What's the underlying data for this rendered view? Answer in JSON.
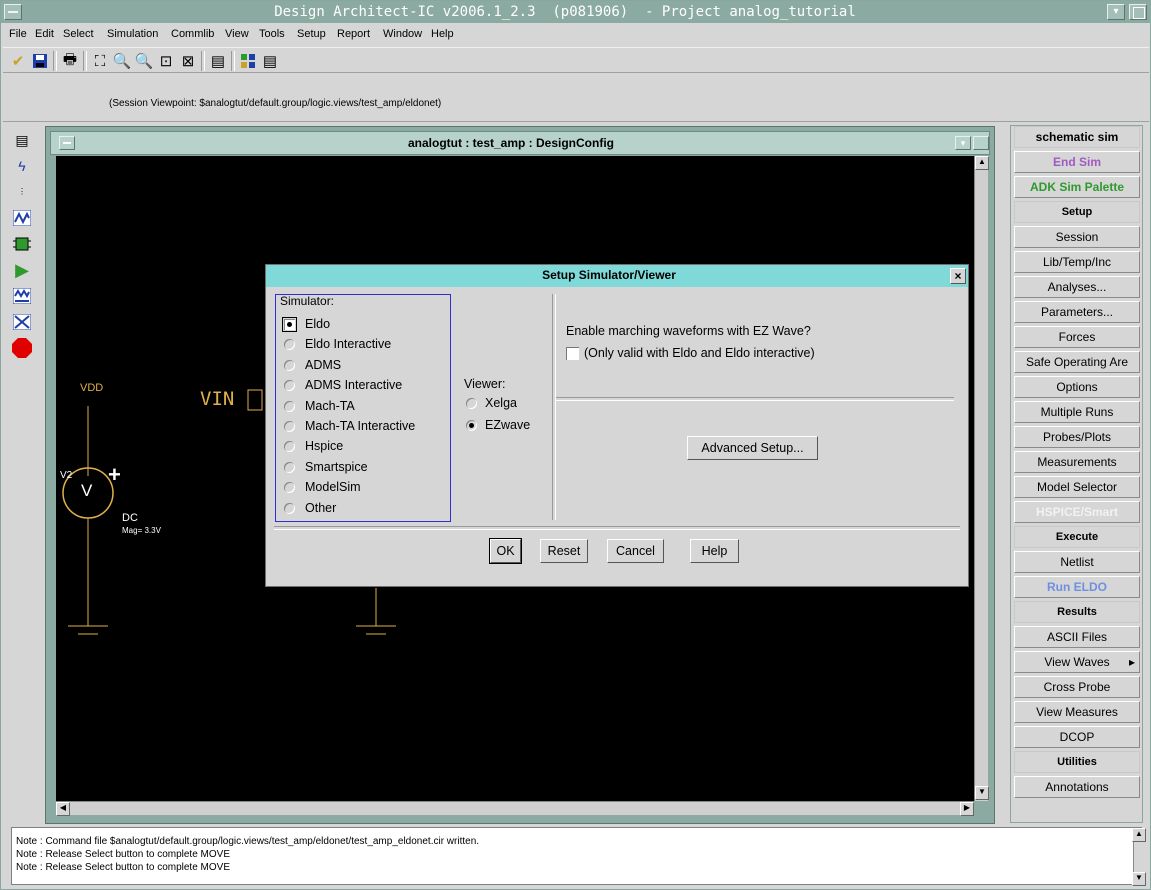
{
  "window": {
    "title": "Design Architect-IC v2006.1_2.3  (p081906)  - Project analog_tutorial"
  },
  "menu": [
    "File",
    "Edit",
    "Select",
    "Simulation",
    "Commlib",
    "View",
    "Tools",
    "Setup",
    "Report",
    "Window",
    "Help"
  ],
  "session_viewpoint": "(Session Viewpoint: $analogtut/default.group/logic.views/test_amp/eldonet)",
  "schematic": {
    "title": "analogtut : test_amp : DesignConfig",
    "vdd_label": "VDD",
    "vin_label": "VIN",
    "v2_label": "V2",
    "plus": "+",
    "source_symbol": "V",
    "dc_label": "DC",
    "mag_label": "Mag= 3.3V"
  },
  "dialog": {
    "title": "Setup Simulator/Viewer",
    "close": "×",
    "simulator_label": "Simulator:",
    "simulators": [
      "Eldo",
      "Eldo Interactive",
      "ADMS",
      "ADMS Interactive",
      "Mach-TA",
      "Mach-TA Interactive",
      "Hspice",
      "Smartspice",
      "ModelSim",
      "Other"
    ],
    "selected_simulator": "Eldo",
    "viewer_label": "Viewer:",
    "viewers": [
      "Xelga",
      "EZwave"
    ],
    "selected_viewer": "EZwave",
    "marching_question": "Enable marching waveforms with EZ Wave?",
    "marching_note": "(Only valid with Eldo and Eldo interactive)",
    "advanced_button": "Advanced Setup...",
    "ok": "OK",
    "reset": "Reset",
    "cancel": "Cancel",
    "help": "Help"
  },
  "palette": {
    "title": "schematic sim",
    "items": [
      {
        "label": "End Sim",
        "kind": "button",
        "color": "#a05ac0"
      },
      {
        "label": "ADK Sim Palette",
        "kind": "button",
        "color": "#2e9a2e"
      },
      {
        "label": "Setup",
        "kind": "header"
      },
      {
        "label": "Session",
        "kind": "button"
      },
      {
        "label": "Lib/Temp/Inc",
        "kind": "button"
      },
      {
        "label": "Analyses...",
        "kind": "button"
      },
      {
        "label": "Parameters...",
        "kind": "button"
      },
      {
        "label": "Forces",
        "kind": "button"
      },
      {
        "label": "Safe Operating Are",
        "kind": "button"
      },
      {
        "label": "Options",
        "kind": "button"
      },
      {
        "label": "Multiple Runs",
        "kind": "button"
      },
      {
        "label": "Probes/Plots",
        "kind": "button"
      },
      {
        "label": "Measurements",
        "kind": "button"
      },
      {
        "label": "Model Selector",
        "kind": "button"
      },
      {
        "label": "HSPICE/Smart",
        "kind": "button",
        "color": "#f2f2f2"
      },
      {
        "label": "Execute",
        "kind": "header"
      },
      {
        "label": "Netlist",
        "kind": "button"
      },
      {
        "label": "Run ELDO",
        "kind": "button",
        "color": "#6f8fe0"
      },
      {
        "label": "Results",
        "kind": "header"
      },
      {
        "label": "ASCII Files",
        "kind": "button"
      },
      {
        "label": "View Waves",
        "kind": "button",
        "submenu": "▸"
      },
      {
        "label": "Cross Probe",
        "kind": "button"
      },
      {
        "label": "View Measures",
        "kind": "button"
      },
      {
        "label": "DCOP",
        "kind": "button"
      },
      {
        "label": "Utilities",
        "kind": "header"
      },
      {
        "label": "Annotations",
        "kind": "button"
      }
    ]
  },
  "status_notes": [
    "Note : Command file $analogtut/default.group/logic.views/test_amp/eldonet/test_amp_eldonet.cir written.",
    "Note : Release Select button to complete MOVE",
    "Note : Release Select button to complete MOVE"
  ],
  "toolbar_icons": [
    "check-icon",
    "save-icon",
    "print-icon",
    "zoom-fit-icon",
    "zoom-in-icon",
    "zoom-out-icon",
    "zoom-area-icon",
    "zoom-sheet-icon",
    "panel-icon",
    "palette-icon",
    "list-icon"
  ],
  "left_icons": [
    "notes-icon",
    "lightning-icon",
    "tran-dc-ac-icon",
    "waveform-icon",
    "chip-icon",
    "play-icon",
    "waveform-compare-icon",
    "cross-probe-icon",
    "stop-icon"
  ],
  "colors": {
    "schematic_wire": "#e0b04a",
    "schematic_text": "#e0b04a",
    "ground": "#e0b04a",
    "plus": "#ffffff",
    "dialog_title": "#7fd9d9",
    "titlebar": "#8aaaa2"
  }
}
